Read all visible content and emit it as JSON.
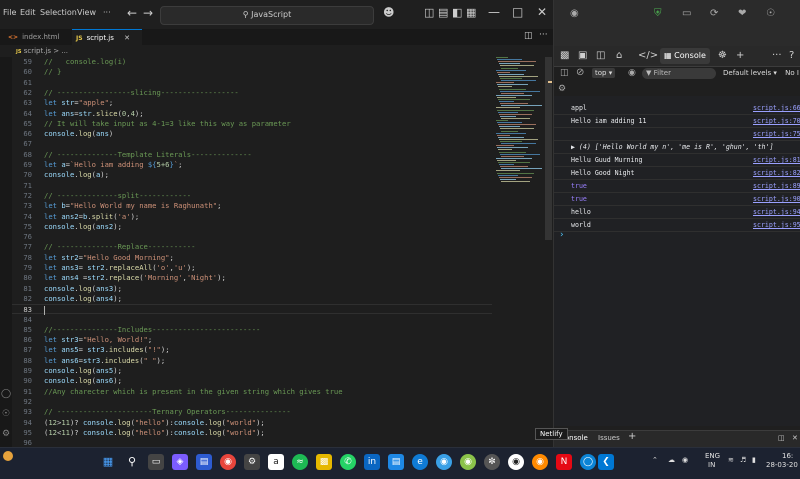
{
  "vscode": {
    "menu": [
      "File",
      "Edit",
      "Selection",
      "View",
      "···"
    ],
    "search_text": "JavaScript",
    "tabs": [
      {
        "label": "index.html",
        "icon": "html-file-icon"
      },
      {
        "label": "script.js",
        "icon": "js-file-icon"
      }
    ],
    "breadcrumb": "script.js > ...",
    "code_lines": [
      {
        "n": "59",
        "text": "//   console.log(i)"
      },
      {
        "n": "60",
        "text": "// }"
      },
      {
        "n": "61",
        "text": ""
      },
      {
        "n": "62",
        "text": "// -----------------slicing------------------"
      },
      {
        "n": "63",
        "text": "let str=\"apple\";"
      },
      {
        "n": "64",
        "text": "let ans=str.slice(0,4);"
      },
      {
        "n": "65",
        "text": "// It will take input as 4-1=3 like this way as parameter"
      },
      {
        "n": "66",
        "text": "console.log(ans)"
      },
      {
        "n": "67",
        "text": ""
      },
      {
        "n": "68",
        "text": "// --------------Template Literals--------------"
      },
      {
        "n": "69",
        "text": "let a=`Hello iam adding ${5+6}`;"
      },
      {
        "n": "70",
        "text": "console.log(a);"
      },
      {
        "n": "71",
        "text": ""
      },
      {
        "n": "72",
        "text": "// --------------split------------"
      },
      {
        "n": "73",
        "text": "let b=\"Hello World my name is Raghunath\";"
      },
      {
        "n": "74",
        "text": "let ans2=b.split('a');"
      },
      {
        "n": "75",
        "text": "console.log(ans2);"
      },
      {
        "n": "76",
        "text": ""
      },
      {
        "n": "77",
        "text": "// --------------Replace-----------"
      },
      {
        "n": "78",
        "text": "let str2=\"Hello Good Morning\";"
      },
      {
        "n": "79",
        "text": "let ans3= str2.replaceAll('o','u');"
      },
      {
        "n": "80",
        "text": "let ans4 =str2.replace('Morning','Night');"
      },
      {
        "n": "81",
        "text": "console.log(ans3);"
      },
      {
        "n": "82",
        "text": "console.log(ans4);"
      },
      {
        "n": "83",
        "text": ""
      },
      {
        "n": "84",
        "text": ""
      },
      {
        "n": "85",
        "text": "//---------------Includes-------------------------"
      },
      {
        "n": "86",
        "text": "let str3=\"Hello, World!\";"
      },
      {
        "n": "87",
        "text": "let ans5= str3.includes(\"!\");"
      },
      {
        "n": "88",
        "text": "let ans6=str3.includes(\" \");"
      },
      {
        "n": "89",
        "text": "console.log(ans5);"
      },
      {
        "n": "90",
        "text": "console.log(ans6);"
      },
      {
        "n": "91",
        "text": "//Any charecter which is present in the given string which gives true"
      },
      {
        "n": "92",
        "text": ""
      },
      {
        "n": "93",
        "text": "// ----------------------Ternary Operators---------------"
      },
      {
        "n": "94",
        "text": "(12>11)? console.log(\"hello\"):console.log(\"world\");"
      },
      {
        "n": "95",
        "text": "(12<11)? console.log(\"hello\"):console.log(\"world\");"
      },
      {
        "n": "96",
        "text": ""
      }
    ]
  },
  "devtools": {
    "console_tab": "Console",
    "context": "top",
    "filter_placeholder": "Filter",
    "levels": "Default levels",
    "issues_label": "No I",
    "messages": [
      {
        "text": "appl",
        "src": "script.js:66",
        "kind": "log"
      },
      {
        "text": "Hello iam adding 11",
        "src": "script.js:70",
        "kind": "log"
      },
      {
        "text": "",
        "src": "script.js:75",
        "kind": "log"
      },
      {
        "text": "▶ (4) ['Hello World my n', 'me is R', 'ghun', 'th']",
        "src": "",
        "kind": "arr"
      },
      {
        "text": "Hellu Guud Murning",
        "src": "script.js:81",
        "kind": "log"
      },
      {
        "text": "Hello Good Night",
        "src": "script.js:82",
        "kind": "log"
      },
      {
        "text": "true",
        "src": "script.js:89",
        "kind": "bool"
      },
      {
        "text": "true",
        "src": "script.js:90",
        "kind": "bool"
      },
      {
        "text": "hello",
        "src": "script.js:94",
        "kind": "log"
      },
      {
        "text": "world",
        "src": "script.js:95",
        "kind": "log"
      }
    ],
    "drawer_tabs": [
      "Console",
      "Issues"
    ],
    "tooltip": "Netlify"
  },
  "taskbar": {
    "lang": "ENG",
    "region": "IN",
    "time": "16:",
    "date": "28-03-20"
  },
  "colors": {
    "accent": "#0078d4",
    "keyword": "#569cd6",
    "string": "#ce9178",
    "comment": "#6a9955",
    "function": "#dcdcaa"
  }
}
